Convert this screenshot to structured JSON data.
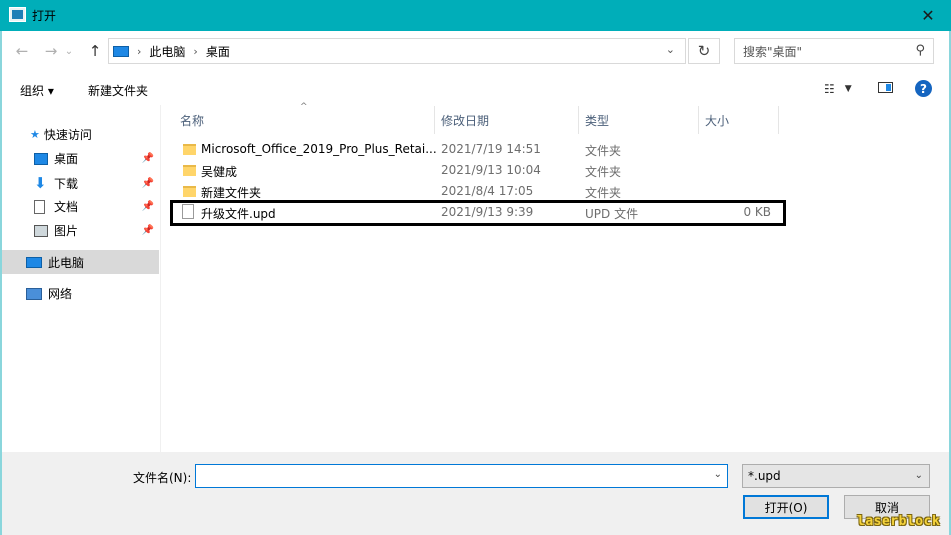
{
  "window": {
    "title": "打开",
    "close_glyph": "✕"
  },
  "nav": {
    "back_glyph": "←",
    "forward_glyph": "→",
    "forward_menu_glyph": "⌄",
    "up_glyph": "↑",
    "breadcrumbs": [
      "此电脑",
      "桌面"
    ],
    "refresh_glyph": "↻"
  },
  "search": {
    "placeholder": "搜索\"桌面\""
  },
  "toolbar": {
    "organize_label": "组织 ▾",
    "new_folder_label": "新建文件夹",
    "help_glyph": "?"
  },
  "sidebar": {
    "items": [
      {
        "label": "快速访问",
        "icon": "star-icon"
      },
      {
        "label": "桌面",
        "icon": "desktop-icon",
        "pinned": true
      },
      {
        "label": "下载",
        "icon": "download-icon",
        "pinned": true
      },
      {
        "label": "文档",
        "icon": "document-icon",
        "pinned": true
      },
      {
        "label": "图片",
        "icon": "picture-icon",
        "pinned": true
      },
      {
        "label": "此电脑",
        "icon": "computer-icon",
        "selected": true
      },
      {
        "label": "网络",
        "icon": "network-icon"
      }
    ]
  },
  "columns": {
    "name": "名称",
    "date": "修改日期",
    "type": "类型",
    "size": "大小"
  },
  "files": [
    {
      "name": "Microsoft_Office_2019_Pro_Plus_Retai...",
      "date": "2021/7/19 14:51",
      "type": "文件夹",
      "size": "",
      "kind": "folder"
    },
    {
      "name": "吴健成",
      "date": "2021/9/13 10:04",
      "type": "文件夹",
      "size": "",
      "kind": "folder"
    },
    {
      "name": "新建文件夹",
      "date": "2021/8/4 17:05",
      "type": "文件夹",
      "size": "",
      "kind": "folder"
    },
    {
      "name": "升级文件.upd",
      "date": "2021/9/13 9:39",
      "type": "UPD 文件",
      "size": "0 KB",
      "kind": "file"
    }
  ],
  "bottom": {
    "filename_label": "文件名(N):",
    "filename_value": "",
    "filetype_value": "*.upd",
    "open_label": "打开(O)",
    "cancel_label": "取消"
  },
  "watermark": "laserblock",
  "colors": {
    "titlebar": "#00aeb9",
    "accent": "#0078d7",
    "selected": "#d9d9d9"
  }
}
